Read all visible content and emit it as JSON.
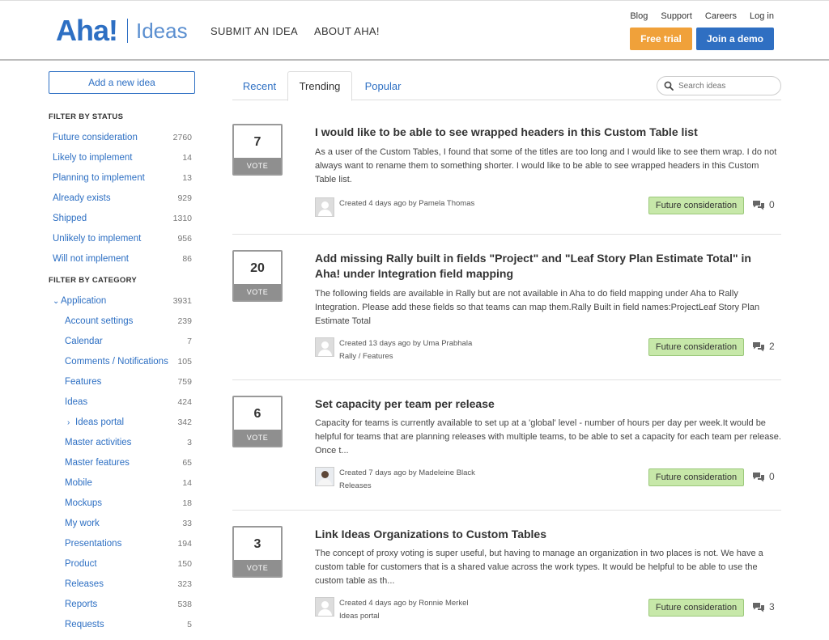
{
  "header": {
    "logo_main": "Aha!",
    "logo_sub": "Ideas",
    "nav": [
      "SUBMIT AN IDEA",
      "ABOUT AHA!"
    ],
    "top_links": [
      "Blog",
      "Support",
      "Careers",
      "Log in"
    ],
    "free_trial": "Free trial",
    "join_demo": "Join a demo",
    "colors": {
      "brand": "#2d6fc3",
      "trial": "#f0a13a",
      "demo": "#2f6fc2"
    }
  },
  "sidebar": {
    "add_idea": "Add a new idea",
    "status_heading": "FILTER BY STATUS",
    "statuses": [
      {
        "label": "Future consideration",
        "count": "2760"
      },
      {
        "label": "Likely to implement",
        "count": "14"
      },
      {
        "label": "Planning to implement",
        "count": "13"
      },
      {
        "label": "Already exists",
        "count": "929"
      },
      {
        "label": "Shipped",
        "count": "1310"
      },
      {
        "label": "Unlikely to implement",
        "count": "956"
      },
      {
        "label": "Will not implement",
        "count": "86"
      }
    ],
    "category_heading": "FILTER BY CATEGORY",
    "categories": [
      {
        "label": "Application",
        "count": "3931"
      },
      {
        "label": "Account settings",
        "count": "239"
      },
      {
        "label": "Calendar",
        "count": "7"
      },
      {
        "label": "Comments / Notifications",
        "count": "105"
      },
      {
        "label": "Features",
        "count": "759"
      },
      {
        "label": "Ideas",
        "count": "424"
      },
      {
        "label": "Ideas portal",
        "count": "342"
      },
      {
        "label": "Master activities",
        "count": "3"
      },
      {
        "label": "Master features",
        "count": "65"
      },
      {
        "label": "Mobile",
        "count": "14"
      },
      {
        "label": "Mockups",
        "count": "18"
      },
      {
        "label": "My work",
        "count": "33"
      },
      {
        "label": "Presentations",
        "count": "194"
      },
      {
        "label": "Product",
        "count": "150"
      },
      {
        "label": "Releases",
        "count": "323"
      },
      {
        "label": "Reports",
        "count": "538"
      },
      {
        "label": "Requests",
        "count": "5"
      }
    ]
  },
  "tabs": [
    "Recent",
    "Trending",
    "Popular"
  ],
  "active_tab": "Trending",
  "search": {
    "placeholder": "Search ideas"
  },
  "vote_label": "VOTE",
  "ideas": [
    {
      "votes": "7",
      "title": "I would like to be able to see wrapped headers in this Custom Table list",
      "description": "As a user of the Custom Tables, I found that some of the titles are too long and I would like to see them wrap. I do not always want to rename them to something shorter. I would like to be able to see wrapped headers in this Custom Table list.",
      "created": "Created 4 days ago by Pamela Thomas",
      "category": "",
      "status": "Future consideration",
      "comments": "0"
    },
    {
      "votes": "20",
      "title": "Add missing Rally built in fields \"Project\" and \"Leaf Story Plan Estimate Total\" in Aha! under Integration field mapping",
      "description": "The following fields are available in Rally but are not available in Aha to do field mapping under Aha to Rally Integration. Please add these fields so that teams can map them.Rally Built in field names:ProjectLeaf Story Plan Estimate Total",
      "created": "Created 13 days ago by Uma Prabhala",
      "category": "Rally / Features",
      "status": "Future consideration",
      "comments": "2"
    },
    {
      "votes": "6",
      "title": "Set capacity per team per release",
      "description": "Capacity for teams is currently available to set up at a 'global' level - number of hours per day per week.It would be helpful for teams that are planning releases with multiple teams, to be able to set a capacity for each team per release. Once t...",
      "created": "Created 7 days ago by Madeleine Black",
      "category": "Releases",
      "status": "Future consideration",
      "comments": "0"
    },
    {
      "votes": "3",
      "title": "Link Ideas Organizations to Custom Tables",
      "description": "The concept of proxy voting is super useful, but having to manage an organization in two places is not. We have a custom table for customers that is a shared value across the work types. It would be helpful to be able to use the custom table as th...",
      "created": "Created 4 days ago by Ronnie Merkel",
      "category": "Ideas portal",
      "status": "Future consideration",
      "comments": "3"
    }
  ]
}
